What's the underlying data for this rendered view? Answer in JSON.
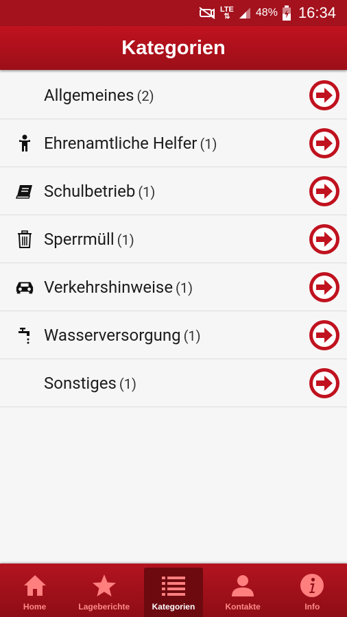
{
  "status_bar": {
    "network": "LTE",
    "battery": "48%",
    "time": "16:34",
    "icons": [
      "mute-icon",
      "lte-icon",
      "signal-icon",
      "battery-icon"
    ]
  },
  "header": {
    "title": "Kategorien"
  },
  "categories": [
    {
      "label": "Allgemeines",
      "count": "(2)",
      "icon": "none"
    },
    {
      "label": "Ehrenamtliche Helfer",
      "count": "(1)",
      "icon": "person-icon"
    },
    {
      "label": "Schulbetrieb",
      "count": "(1)",
      "icon": "book-icon"
    },
    {
      "label": "Sperrmüll",
      "count": "(1)",
      "icon": "trash-icon"
    },
    {
      "label": "Verkehrshinweise",
      "count": "(1)",
      "icon": "car-icon"
    },
    {
      "label": "Wasserversorgung",
      "count": "(1)",
      "icon": "faucet-icon"
    },
    {
      "label": "Sonstiges",
      "count": "(1)",
      "icon": "none"
    }
  ],
  "bottom_nav": [
    {
      "label": "Home",
      "icon": "home-icon",
      "active": false
    },
    {
      "label": "Lageberichte",
      "icon": "star-icon",
      "active": false
    },
    {
      "label": "Kategorien",
      "icon": "list-icon",
      "active": true
    },
    {
      "label": "Kontakte",
      "icon": "person-icon",
      "active": false
    },
    {
      "label": "Info",
      "icon": "info-icon",
      "active": false
    }
  ],
  "colors": {
    "primary": "#a3121d",
    "header": "#c0121f",
    "nav_active": "#6d0a10",
    "nav_icon": "#ff7f7f",
    "arrow": "#c0121f",
    "background": "#f6f6f6"
  }
}
